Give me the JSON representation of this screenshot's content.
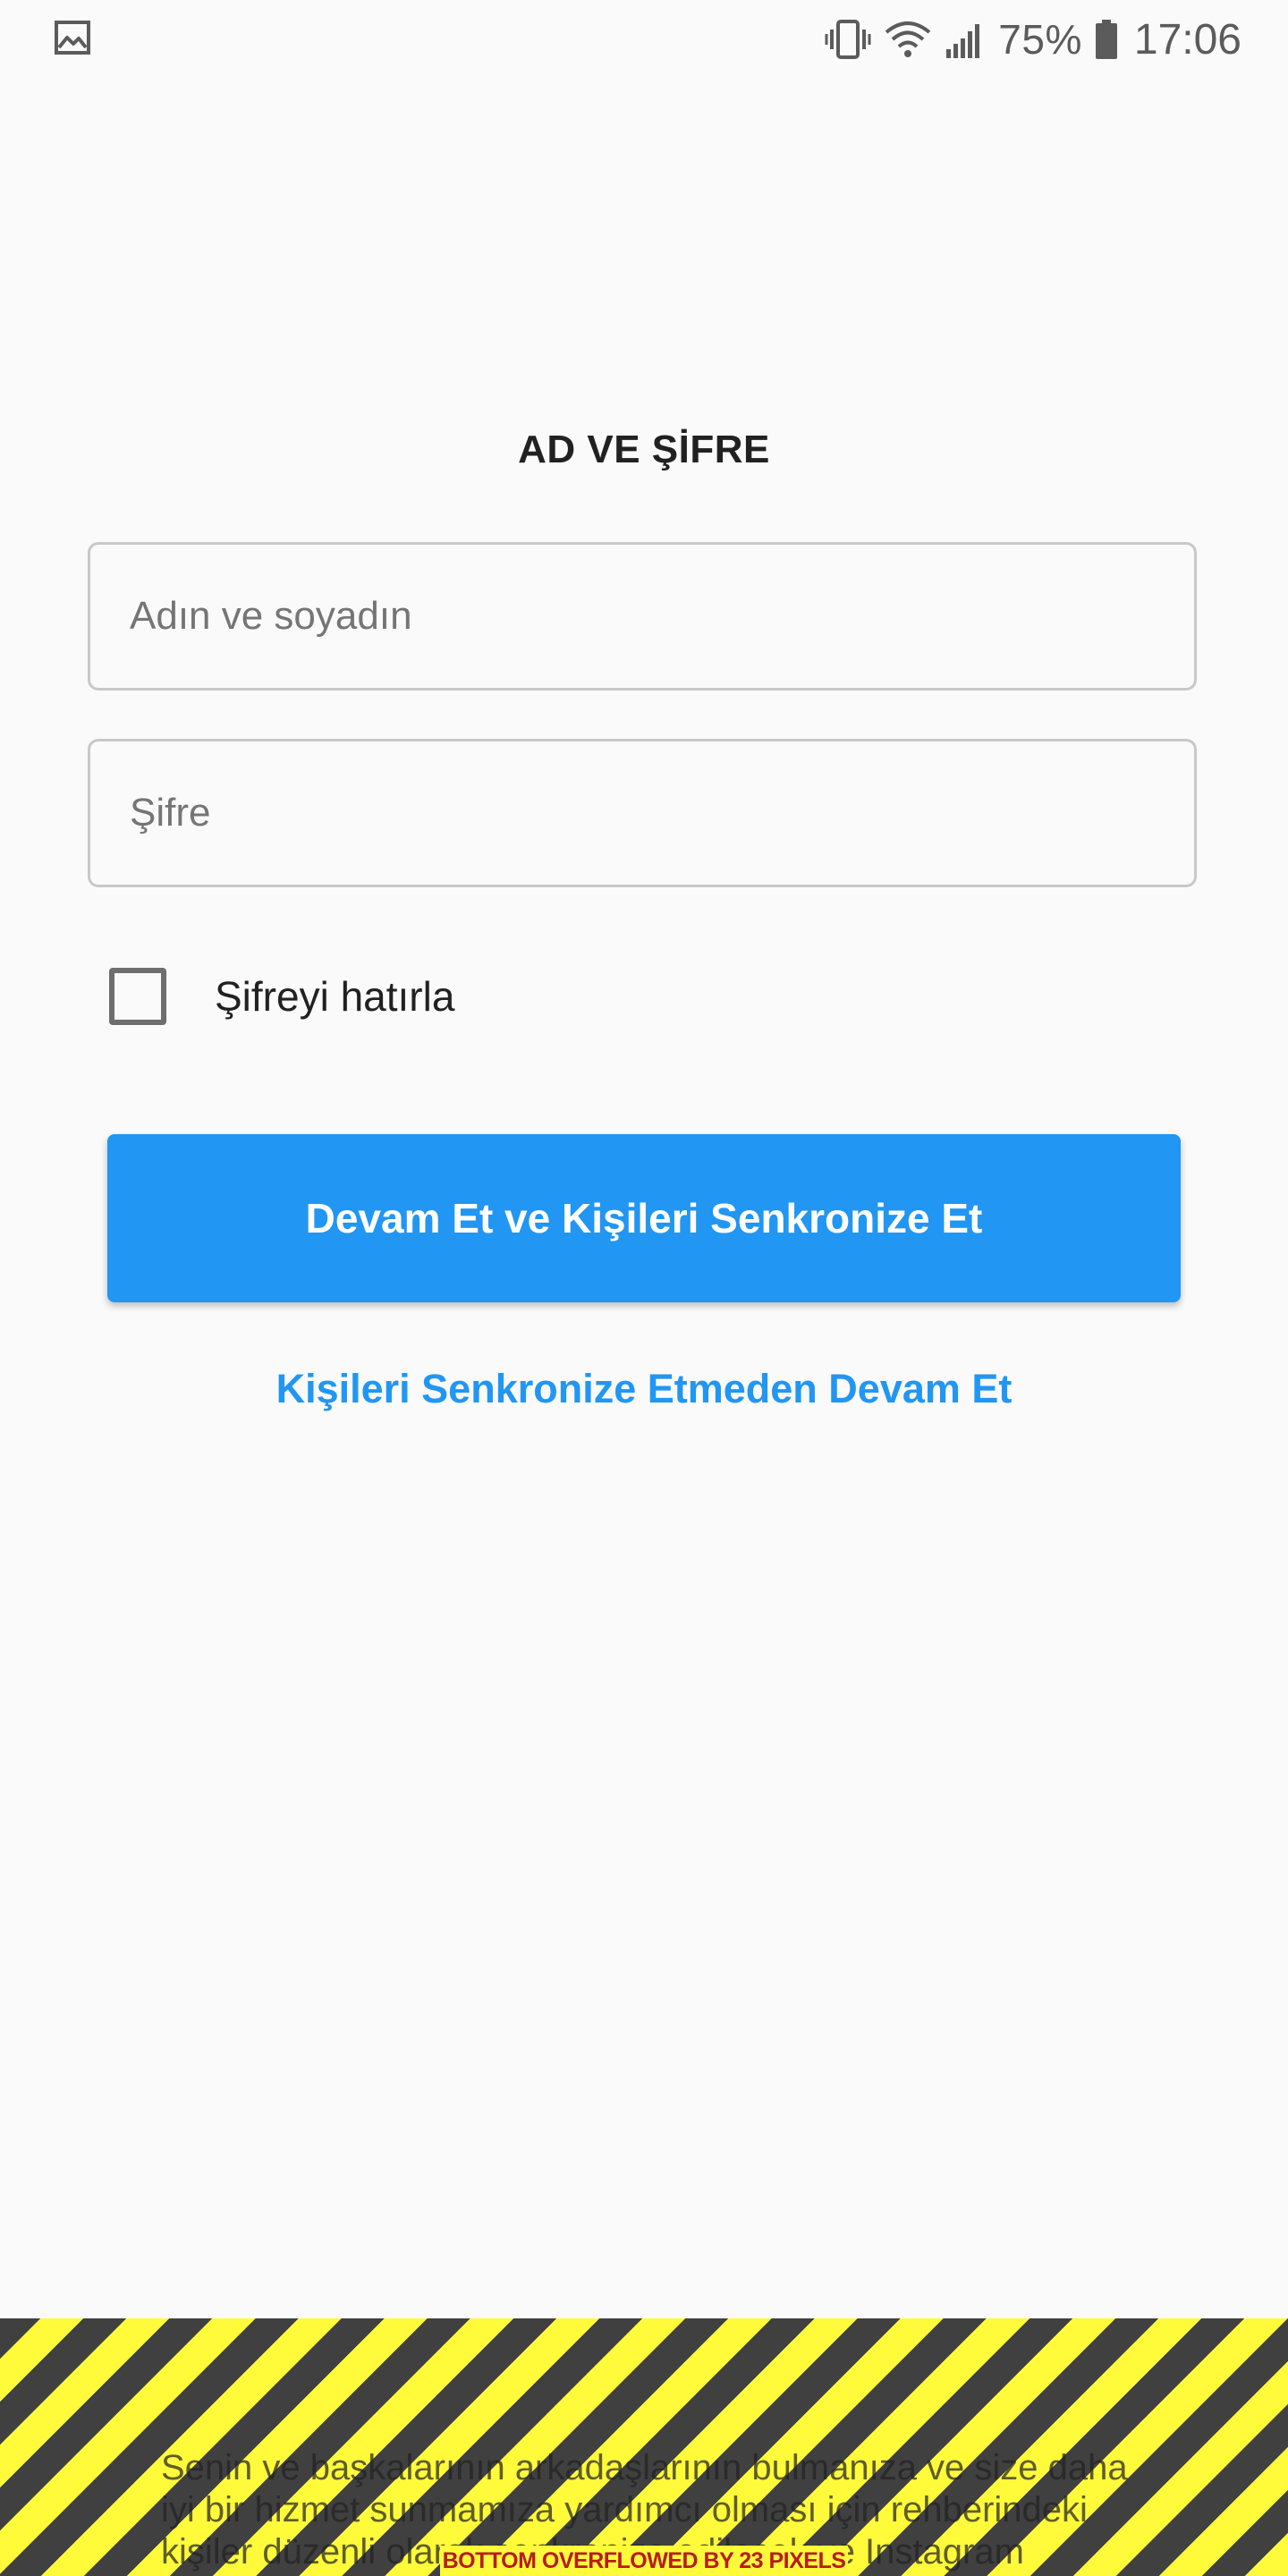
{
  "status_bar": {
    "left_icon": "gallery-icon",
    "icons": [
      "vibrate-icon",
      "wifi-icon",
      "cell-signal-icon",
      "battery-icon"
    ],
    "battery_percent": "75%",
    "time": "17:06"
  },
  "form": {
    "title": "AD VE ŞİFRE",
    "name_placeholder": "Adın ve soyadın",
    "name_value": "",
    "password_placeholder": "Şifre",
    "password_value": "",
    "remember_label": "Şifreyi hatırla",
    "remember_checked": false,
    "primary_button": "Devam Et ve Kişileri Senkronize Et",
    "secondary_button": "Kişileri Senkronize Etmeden Devam Et"
  },
  "footer": {
    "disclaimer": "Senin ve başkalarının arkadaşlarının bulmanıza ve size daha iyi bir hizmet sunmamıza yardımcı olması için rehberindeki kişiler düzenli olarak senkronize edilecek ve Instagram sunucularında",
    "overflow_label": "BOTTOM OVERFLOWED BY 23 PIXELS"
  },
  "colors": {
    "primary": "#2196f3",
    "background": "#fafafa",
    "overflow_yellow": "#fffb3b",
    "overflow_dark": "#404040",
    "overflow_text": "#b71c1c"
  }
}
